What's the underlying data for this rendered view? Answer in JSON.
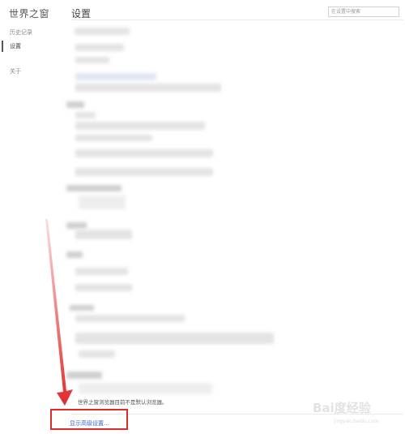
{
  "app": {
    "title": "世界之窗"
  },
  "sidebar": {
    "items": [
      {
        "label": "历史记录"
      },
      {
        "label": "设置"
      },
      {
        "label": "关于"
      }
    ]
  },
  "header": {
    "title": "设置",
    "search_placeholder": "在设置中搜索"
  },
  "content": {
    "default_browser_note": "世界之窗浏览器目前不是默认浏览器。",
    "show_advanced_link": "显示高级设置..."
  },
  "watermark": {
    "logo": "Bai度经验",
    "sub": "jingyan.baidu.com"
  },
  "colors": {
    "link": "#3d63c9",
    "annotation": "#e02a2a",
    "search_border": "#c7d8c3"
  }
}
